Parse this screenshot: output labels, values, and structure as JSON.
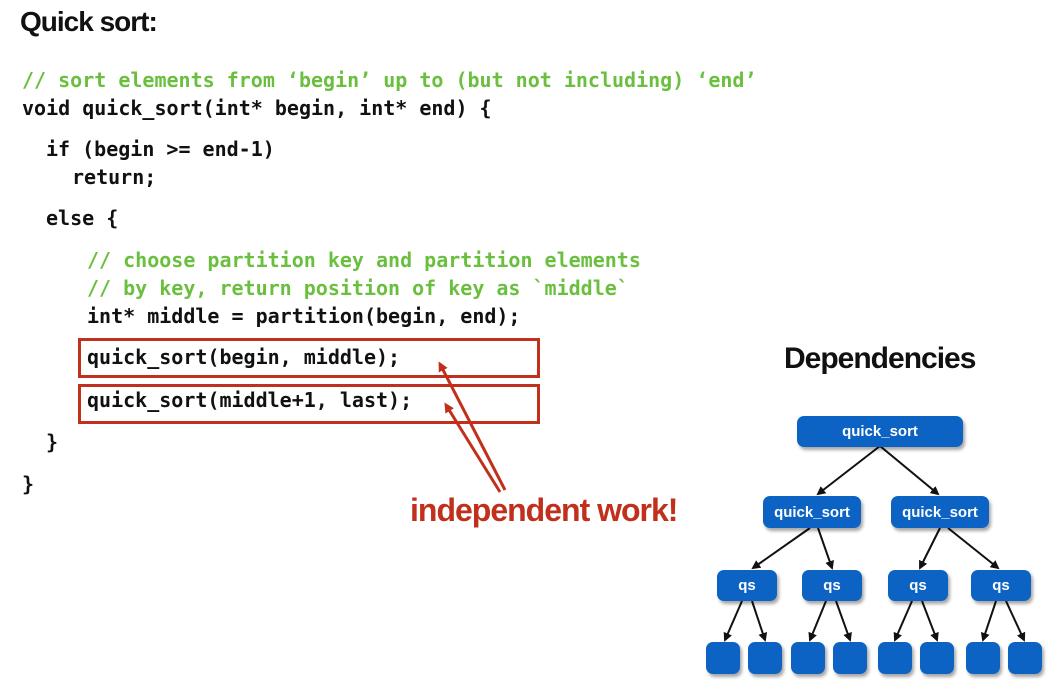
{
  "title": "Quick sort:",
  "code": {
    "line1_comment": "// sort elements from ‘begin’ up to (but not including) ‘end’",
    "line2": "void quick_sort(int* begin, int* end) {",
    "line3": "if (begin >= end-1)",
    "line4": "return;",
    "line5": "else {",
    "line6_comment": "// choose partition key and partition elements",
    "line7_comment": "// by key, return position of key as `middle`",
    "line8": "int* middle = partition(begin, end);",
    "line9": "quick_sort(begin, middle);",
    "line10": "quick_sort(middle+1, last);",
    "line11": "}",
    "line12": "}"
  },
  "callout": "independent work!",
  "dependencies": {
    "title": "Dependencies",
    "root": "quick_sort",
    "level2": [
      "quick_sort",
      "quick_sort"
    ],
    "level3": [
      "qs",
      "qs",
      "qs",
      "qs"
    ],
    "leaf_count": 8
  },
  "colors": {
    "comment": "#6bbf3f",
    "highlight": "#c0301c",
    "node": "#0d63c4"
  }
}
